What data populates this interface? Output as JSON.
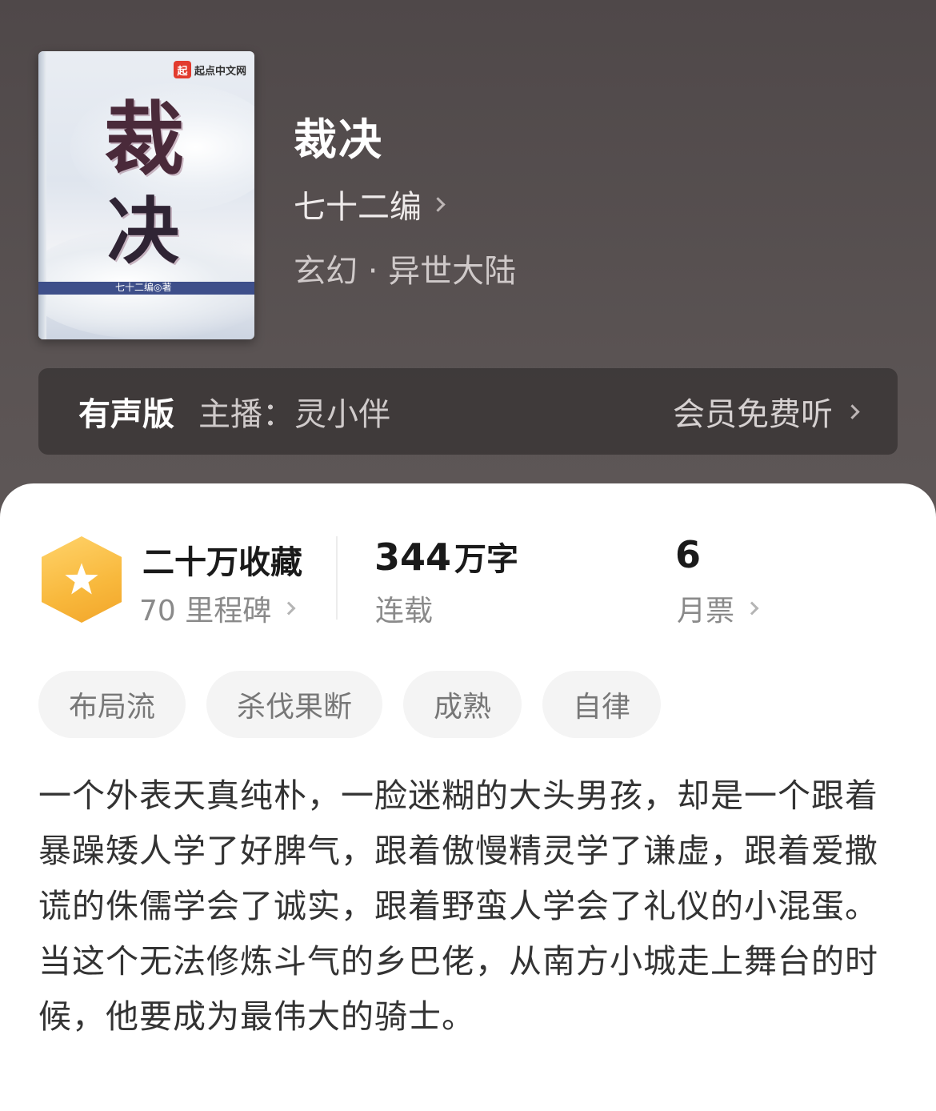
{
  "book": {
    "title": "裁决",
    "author": "七十二编",
    "genre": "玄幻 · 异世大陆",
    "cover": {
      "publisher_logo": "起点中文网",
      "logo_badge": "起",
      "cover_title_1": "裁",
      "cover_title_2": "决",
      "cover_author": "七十二编◎著"
    }
  },
  "audio": {
    "label": "有声版",
    "host": "主播：灵小伴",
    "cta": "会员免费听"
  },
  "stats": {
    "collections": "二十万收藏",
    "milestones": "70 里程碑",
    "word_count_num": "344",
    "word_count_unit": "万字",
    "status": "连载",
    "monthly_votes": "6",
    "monthly_votes_label": "月票"
  },
  "tags": [
    "布局流",
    "杀伐果断",
    "成熟",
    "自律"
  ],
  "description": {
    "para1": "一个外表天真纯朴，一脸迷糊的大头男孩，却是一个跟着暴躁矮人学了好脾气，跟着傲慢精灵学了谦虚，跟着爱撒谎的侏儒学会了诚实，跟着野蛮人学会了礼仪的小混蛋。",
    "para2": "当这个无法修炼斗气的乡巴佬，从南方小城走上舞台的时候，他要成为最伟大的骑士。"
  },
  "colors": {
    "header_bg": "#564f4f",
    "hex_badge": "#f8b83c",
    "tag_bg": "#f4f4f4"
  }
}
